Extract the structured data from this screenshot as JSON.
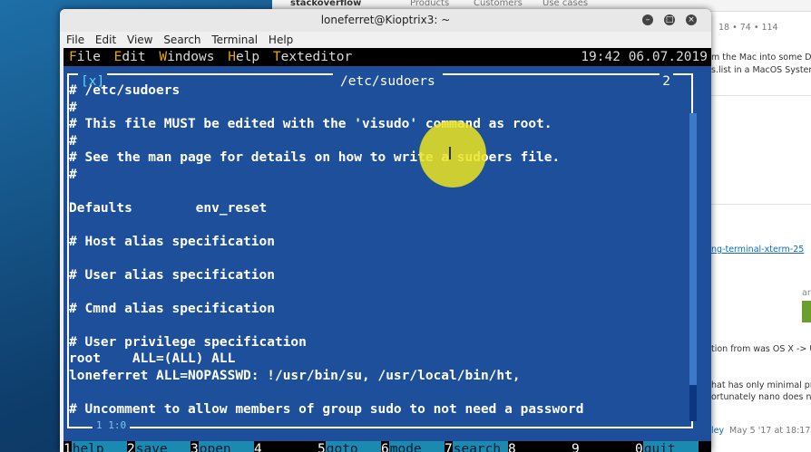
{
  "browser": {
    "logo": "stackoverflow",
    "tabs": [
      "Products",
      "Customers",
      "Use cases"
    ],
    "snippets": {
      "votes": "18 • 74 • 114",
      "line1": "m the Mac into some D",
      "line2": "s.list in a MacOS Syster",
      "link": "ng-terminal-xterm-25",
      "ar": "ar",
      "line3": "tion from was OS X -> U",
      "line4": "hat has only minimal pro",
      "line5": "ortunately nano does not",
      "footer_user": "ley",
      "footer_date": "May 5 '17 at 18:17"
    }
  },
  "terminal": {
    "title": "loneferret@Kioptrix3: ~",
    "menu": [
      "File",
      "Edit",
      "View",
      "Search",
      "Terminal",
      "Help"
    ]
  },
  "mc": {
    "menu": [
      {
        "hot": "F",
        "rest": "ile"
      },
      {
        "hot": "E",
        "rest": "dit"
      },
      {
        "hot": "W",
        "rest": "indows"
      },
      {
        "hot": "H",
        "rest": "elp"
      },
      {
        "hot": "T",
        "rest": "exteditor"
      }
    ],
    "clock": "19:42 06.07.2019",
    "close_box": "[x]",
    "file_title": "/etc/sudoers",
    "window_number": "2",
    "status_pos": "1 1:0",
    "lines": [
      "# /etc/sudoers",
      "#",
      "# This file MUST be edited with the 'visudo' command as root.",
      "#",
      "# See the man page for details on how to write a sudoers file.",
      "#",
      "",
      "Defaults        env_reset",
      "",
      "# Host alias specification",
      "",
      "# User alias specification",
      "",
      "# Cmnd alias specification",
      "",
      "# User privilege specification",
      "root    ALL=(ALL) ALL",
      "loneferret ALL=NOPASSWD: !/usr/bin/su, /usr/local/bin/ht,",
      "",
      "# Uncomment to allow members of group sudo to not need a password"
    ],
    "fkeys": [
      {
        "num": "1",
        "label": "help"
      },
      {
        "num": "2",
        "label": "save"
      },
      {
        "num": "3",
        "label": "open"
      },
      {
        "num": "4",
        "label": ""
      },
      {
        "num": "5",
        "label": "goto"
      },
      {
        "num": "6",
        "label": "mode"
      },
      {
        "num": "7",
        "label": "search"
      },
      {
        "num": "8",
        "label": ""
      },
      {
        "num": "9",
        "label": ""
      },
      {
        "num": "0",
        "label": "quit"
      }
    ]
  }
}
